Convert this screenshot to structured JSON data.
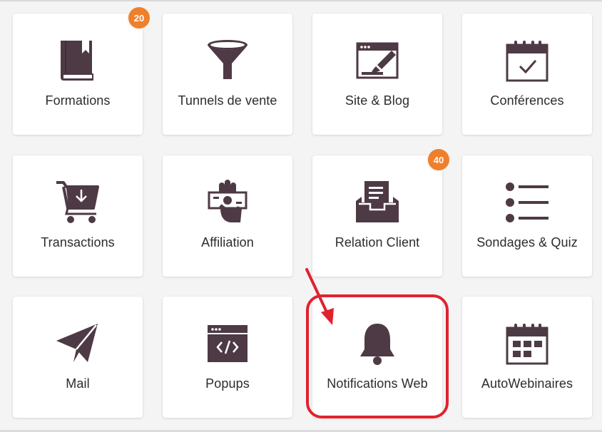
{
  "colors": {
    "icon": "#4d3a45",
    "badge": "#f07f2b",
    "highlight": "#e0222e",
    "text": "#2f2a30",
    "background": "#f4f4f5"
  },
  "tiles": [
    {
      "label": "Formations",
      "icon": "book-icon",
      "badge": "20"
    },
    {
      "label": "Tunnels de vente",
      "icon": "funnel-icon"
    },
    {
      "label": "Site & Blog",
      "icon": "browser-pen-icon"
    },
    {
      "label": "Conférences",
      "icon": "calendar-check-icon"
    },
    {
      "label": "Transactions",
      "icon": "cart-icon"
    },
    {
      "label": "Affiliation",
      "icon": "hand-money-icon"
    },
    {
      "label": "Relation Client",
      "icon": "inbox-tray-icon",
      "badge": "40"
    },
    {
      "label": "Sondages & Quiz",
      "icon": "list-icon"
    },
    {
      "label": "Mail",
      "icon": "paper-plane-icon"
    },
    {
      "label": "Popups",
      "icon": "code-window-icon"
    },
    {
      "label": "Notifications Web",
      "icon": "bell-icon"
    },
    {
      "label": "AutoWebinaires",
      "icon": "calendar-grid-icon"
    }
  ]
}
